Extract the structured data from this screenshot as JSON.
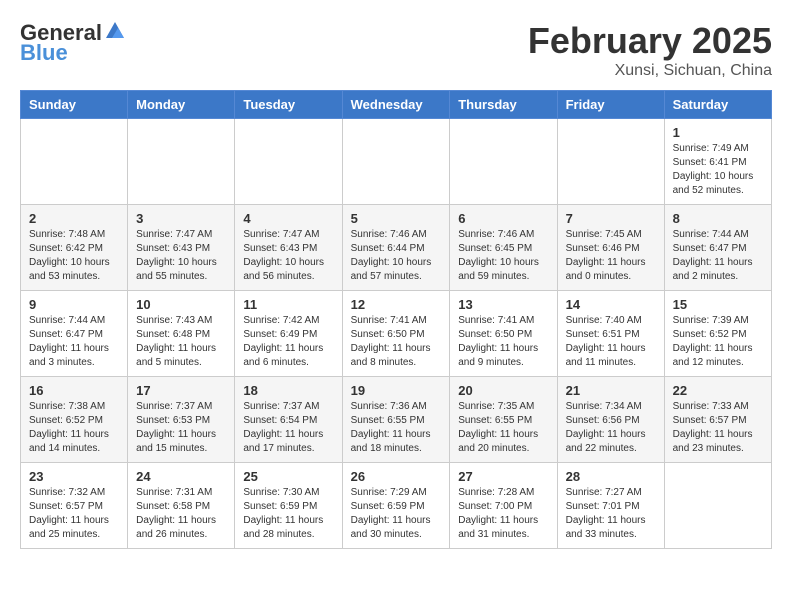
{
  "header": {
    "logo_general": "General",
    "logo_blue": "Blue",
    "month_title": "February 2025",
    "location": "Xunsi, Sichuan, China"
  },
  "days_of_week": [
    "Sunday",
    "Monday",
    "Tuesday",
    "Wednesday",
    "Thursday",
    "Friday",
    "Saturday"
  ],
  "weeks": [
    [
      {
        "day": "",
        "info": ""
      },
      {
        "day": "",
        "info": ""
      },
      {
        "day": "",
        "info": ""
      },
      {
        "day": "",
        "info": ""
      },
      {
        "day": "",
        "info": ""
      },
      {
        "day": "",
        "info": ""
      },
      {
        "day": "1",
        "info": "Sunrise: 7:49 AM\nSunset: 6:41 PM\nDaylight: 10 hours and 52 minutes."
      }
    ],
    [
      {
        "day": "2",
        "info": "Sunrise: 7:48 AM\nSunset: 6:42 PM\nDaylight: 10 hours and 53 minutes."
      },
      {
        "day": "3",
        "info": "Sunrise: 7:47 AM\nSunset: 6:43 PM\nDaylight: 10 hours and 55 minutes."
      },
      {
        "day": "4",
        "info": "Sunrise: 7:47 AM\nSunset: 6:43 PM\nDaylight: 10 hours and 56 minutes."
      },
      {
        "day": "5",
        "info": "Sunrise: 7:46 AM\nSunset: 6:44 PM\nDaylight: 10 hours and 57 minutes."
      },
      {
        "day": "6",
        "info": "Sunrise: 7:46 AM\nSunset: 6:45 PM\nDaylight: 10 hours and 59 minutes."
      },
      {
        "day": "7",
        "info": "Sunrise: 7:45 AM\nSunset: 6:46 PM\nDaylight: 11 hours and 0 minutes."
      },
      {
        "day": "8",
        "info": "Sunrise: 7:44 AM\nSunset: 6:47 PM\nDaylight: 11 hours and 2 minutes."
      }
    ],
    [
      {
        "day": "9",
        "info": "Sunrise: 7:44 AM\nSunset: 6:47 PM\nDaylight: 11 hours and 3 minutes."
      },
      {
        "day": "10",
        "info": "Sunrise: 7:43 AM\nSunset: 6:48 PM\nDaylight: 11 hours and 5 minutes."
      },
      {
        "day": "11",
        "info": "Sunrise: 7:42 AM\nSunset: 6:49 PM\nDaylight: 11 hours and 6 minutes."
      },
      {
        "day": "12",
        "info": "Sunrise: 7:41 AM\nSunset: 6:50 PM\nDaylight: 11 hours and 8 minutes."
      },
      {
        "day": "13",
        "info": "Sunrise: 7:41 AM\nSunset: 6:50 PM\nDaylight: 11 hours and 9 minutes."
      },
      {
        "day": "14",
        "info": "Sunrise: 7:40 AM\nSunset: 6:51 PM\nDaylight: 11 hours and 11 minutes."
      },
      {
        "day": "15",
        "info": "Sunrise: 7:39 AM\nSunset: 6:52 PM\nDaylight: 11 hours and 12 minutes."
      }
    ],
    [
      {
        "day": "16",
        "info": "Sunrise: 7:38 AM\nSunset: 6:52 PM\nDaylight: 11 hours and 14 minutes."
      },
      {
        "day": "17",
        "info": "Sunrise: 7:37 AM\nSunset: 6:53 PM\nDaylight: 11 hours and 15 minutes."
      },
      {
        "day": "18",
        "info": "Sunrise: 7:37 AM\nSunset: 6:54 PM\nDaylight: 11 hours and 17 minutes."
      },
      {
        "day": "19",
        "info": "Sunrise: 7:36 AM\nSunset: 6:55 PM\nDaylight: 11 hours and 18 minutes."
      },
      {
        "day": "20",
        "info": "Sunrise: 7:35 AM\nSunset: 6:55 PM\nDaylight: 11 hours and 20 minutes."
      },
      {
        "day": "21",
        "info": "Sunrise: 7:34 AM\nSunset: 6:56 PM\nDaylight: 11 hours and 22 minutes."
      },
      {
        "day": "22",
        "info": "Sunrise: 7:33 AM\nSunset: 6:57 PM\nDaylight: 11 hours and 23 minutes."
      }
    ],
    [
      {
        "day": "23",
        "info": "Sunrise: 7:32 AM\nSunset: 6:57 PM\nDaylight: 11 hours and 25 minutes."
      },
      {
        "day": "24",
        "info": "Sunrise: 7:31 AM\nSunset: 6:58 PM\nDaylight: 11 hours and 26 minutes."
      },
      {
        "day": "25",
        "info": "Sunrise: 7:30 AM\nSunset: 6:59 PM\nDaylight: 11 hours and 28 minutes."
      },
      {
        "day": "26",
        "info": "Sunrise: 7:29 AM\nSunset: 6:59 PM\nDaylight: 11 hours and 30 minutes."
      },
      {
        "day": "27",
        "info": "Sunrise: 7:28 AM\nSunset: 7:00 PM\nDaylight: 11 hours and 31 minutes."
      },
      {
        "day": "28",
        "info": "Sunrise: 7:27 AM\nSunset: 7:01 PM\nDaylight: 11 hours and 33 minutes."
      },
      {
        "day": "",
        "info": ""
      }
    ]
  ]
}
